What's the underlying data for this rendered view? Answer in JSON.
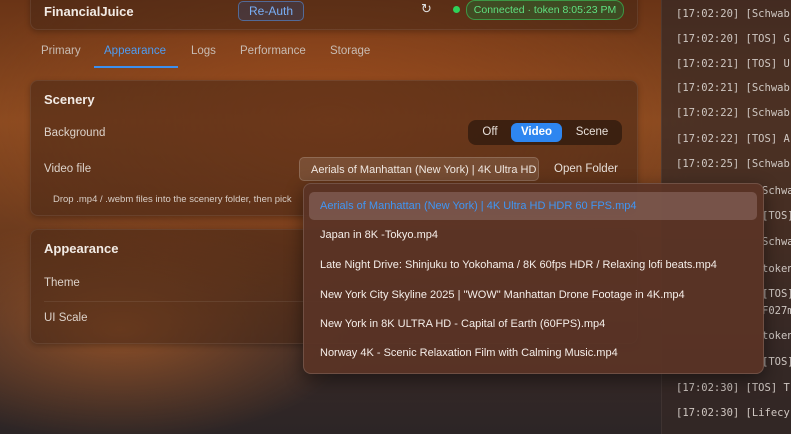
{
  "connection": {
    "name": "FinancialJuice",
    "reauth_label": "Re-Auth",
    "refresh_icon": "↻",
    "status_text": "Connected · token 8:05:23 PM",
    "status_color": "#2fd15a"
  },
  "tabs": [
    {
      "label": "Primary"
    },
    {
      "label": "Appearance",
      "active": true
    },
    {
      "label": "Logs"
    },
    {
      "label": "Performance"
    },
    {
      "label": "Storage"
    }
  ],
  "scenery": {
    "title": "Scenery",
    "background_label": "Background",
    "background_options": [
      "Off",
      "Video",
      "Scene"
    ],
    "background_selected": "Video",
    "video_file_label": "Video file",
    "video_file_value": "Aerials of Manhattan (New York) | 4K Ultra HD HDR 60 FPS.mp4",
    "open_folder_label": "Open Folder",
    "drop_hint": "Drop .mp4 / .webm files into the scenery folder, then pick"
  },
  "appearance": {
    "title": "Appearance",
    "theme_label": "Theme",
    "ui_scale_label": "UI Scale"
  },
  "video_options": [
    "Aerials of Manhattan (New York) | 4K Ultra HD HDR 60 FPS.mp4",
    "Japan in 8K -Tokyo.mp4",
    "Late Night Drive: Shinjuku to Yokohama / 8K 60fps HDR / Relaxing lofi beats.mp4",
    "New York City Skyline 2025 | \"WOW\" Manhattan Drone Footage in 4K.mp4",
    "New York in 8K ULTRA HD - Capital of Earth (60FPS).mp4",
    "Norway 4K - Scenic Relaxation Film with Calming Music.mp4"
  ],
  "log_lines": [
    "[17:02:20] [Schwab",
    "[17:02:20] [TOS] G",
    "[17:02:21] [TOS] U",
    "[17:02:21] [Schwab",
    "[17:02:22] [Schwab",
    "[17:02:22] [TOS] A",
    "[17:02:25] [Schwab",
    "Schwab",
    "[TOS] U",
    "Schwab",
    "token",
    "[TOS] U",
    "F027m",
    "token",
    "[TOS] U",
    "[17:02:30] [TOS] T",
    "[17:02:30] [Lifecy"
  ],
  "colors": {
    "accent": "#2e86f0",
    "link": "#4e9cf2",
    "connected": "#5fe07f"
  }
}
